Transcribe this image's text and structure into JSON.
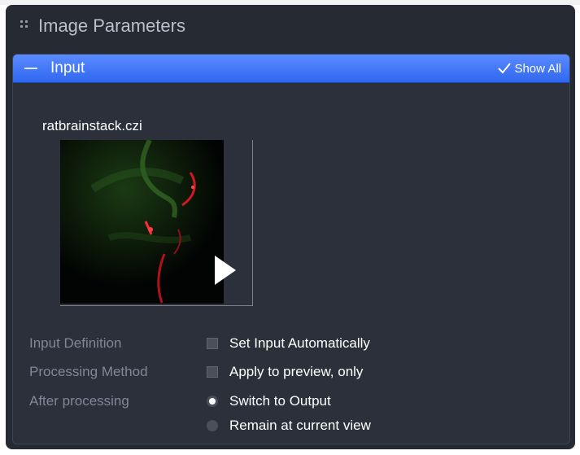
{
  "panel": {
    "title": "Image Parameters"
  },
  "input_section": {
    "title": "Input",
    "show_all_label": "Show All",
    "file_name": "ratbrainstack.czi"
  },
  "form": {
    "input_definition": {
      "label": "Input Definition",
      "checkbox_label": "Set Input Automatically",
      "checked": false
    },
    "processing_method": {
      "label": "Processing Method",
      "checkbox_label": "Apply to preview, only",
      "checked": false
    },
    "after_processing": {
      "label": "After processing",
      "options": [
        {
          "label": "Switch to Output",
          "selected": true
        },
        {
          "label": "Remain at current view",
          "selected": false
        }
      ]
    }
  },
  "colors": {
    "panel_bg": "#262a33",
    "section_header": "#2f67f0",
    "text_primary": "#ffffff",
    "text_muted": "#808797"
  }
}
